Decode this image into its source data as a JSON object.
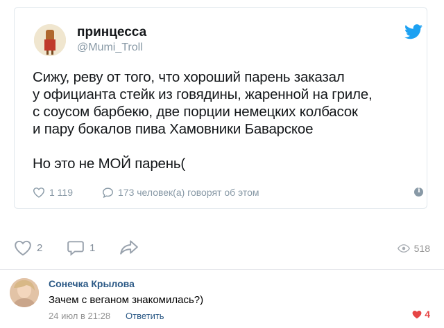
{
  "tweet": {
    "author_name": "принцесса",
    "handle": "@Mumi_Troll",
    "text_lines": [
      "Сижу, реву от того, что хороший парень заказал",
      "у официанта стейк из говядины, жаренной на гриле,",
      "с соусом барбекю, две порции немецких колбасок",
      "и пару бокалов пива Хамовники Баварское"
    ],
    "text_last": "Но это не МОЙ парень(",
    "likes": "1 119",
    "talking": "173 человек(а) говорят об этом",
    "icons": {
      "like": "heart-outline-icon",
      "reply": "speech-bubble-icon",
      "bird": "twitter-bird-icon",
      "info": "info-icon"
    },
    "colors": {
      "bird": "#1da1f2",
      "muted": "#8899a6"
    }
  },
  "post_actions": {
    "likes": "2",
    "comments": "1",
    "views": "518"
  },
  "comment": {
    "author": "Сонечка Крылова",
    "text": "Зачем с веганом знакомилась?)",
    "timestamp": "24 июл в 21:28",
    "reply_label": "Ответить",
    "likes": "4",
    "colors": {
      "link": "#2a5885",
      "like": "#e64646"
    }
  }
}
